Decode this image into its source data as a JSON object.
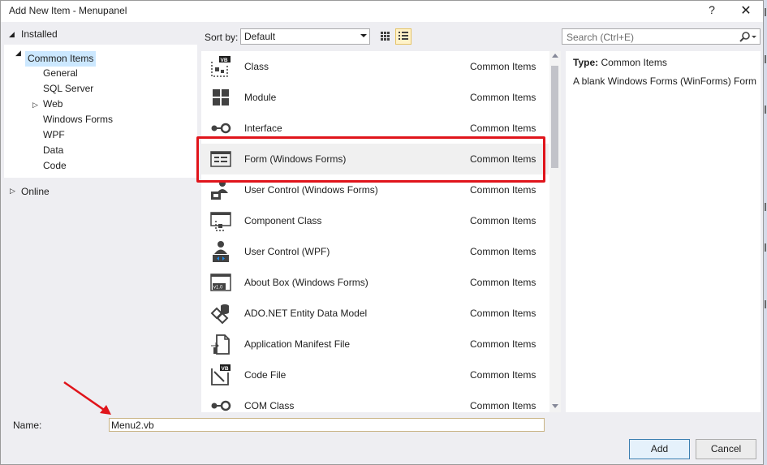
{
  "window": {
    "title": "Add New Item - Menupanel",
    "help_glyph": "?",
    "close_glyph": "✕"
  },
  "tree": {
    "installed_label": "Installed",
    "items": [
      {
        "label": "Common Items"
      },
      {
        "label": "General"
      },
      {
        "label": "SQL Server"
      },
      {
        "label": "Web"
      },
      {
        "label": "Windows Forms"
      },
      {
        "label": "WPF"
      },
      {
        "label": "Data"
      },
      {
        "label": "Code"
      }
    ],
    "online_label": "Online"
  },
  "toolbar": {
    "sort_label": "Sort by:",
    "sort_value": "Default",
    "search_placeholder": "Search (Ctrl+E)"
  },
  "templates": [
    {
      "name": "Class",
      "category": "Common Items",
      "icon": "vb-class-icon"
    },
    {
      "name": "Module",
      "category": "Common Items",
      "icon": "module-icon"
    },
    {
      "name": "Interface",
      "category": "Common Items",
      "icon": "interface-icon"
    },
    {
      "name": "Form (Windows Forms)",
      "category": "Common Items",
      "icon": "form-icon"
    },
    {
      "name": "User Control (Windows Forms)",
      "category": "Common Items",
      "icon": "user-control-icon"
    },
    {
      "name": "Component Class",
      "category": "Common Items",
      "icon": "component-class-icon"
    },
    {
      "name": "User Control (WPF)",
      "category": "Common Items",
      "icon": "wpf-user-control-icon"
    },
    {
      "name": "About Box (Windows Forms)",
      "category": "Common Items",
      "icon": "about-box-icon"
    },
    {
      "name": "ADO.NET Entity Data Model",
      "category": "Common Items",
      "icon": "entity-data-model-icon"
    },
    {
      "name": "Application Manifest File",
      "category": "Common Items",
      "icon": "manifest-file-icon"
    },
    {
      "name": "Code File",
      "category": "Common Items",
      "icon": "code-file-icon"
    },
    {
      "name": "COM Class",
      "category": "Common Items",
      "icon": "com-class-icon"
    }
  ],
  "details": {
    "type_label": "Type:",
    "type_value": "Common Items",
    "description": "A blank Windows Forms (WinForms) Form"
  },
  "bottom": {
    "name_label": "Name:",
    "name_value": "Menu2.vb",
    "add_label": "Add",
    "cancel_label": "Cancel"
  },
  "colors": {
    "accent_select": "#cce8ff",
    "annotation_red": "#e0141b",
    "primary_border": "#3c7fb1"
  }
}
